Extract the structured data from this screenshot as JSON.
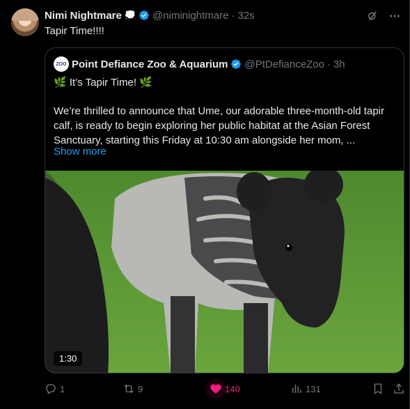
{
  "author": {
    "name": "Nimi Nightmare",
    "emoji": "💭",
    "handle": "@niminightmare",
    "separator": "·",
    "time": "32s"
  },
  "tweet": {
    "text": "Tapir Time!!!!"
  },
  "quoted": {
    "logo_text": "ZOO",
    "name": "Point Defiance Zoo & Aquarium",
    "handle": "@PtDefianceZoo",
    "separator": "·",
    "time": "3h",
    "title": "🌿 It’s Tapir Time! 🌿",
    "body": "We’re thrilled to announce that Ume, our adorable three-month-old tapir calf, is ready to begin exploring her public habitat at the Asian Forest Sanctuary, starting this Friday at 10:30 am alongside her mom, ...",
    "show_more": "Show more",
    "video_duration": "1:30"
  },
  "actions": {
    "replies": "1",
    "reposts": "9",
    "likes": "140",
    "views": "131"
  },
  "icons": {
    "verified": "verified-badge-icon",
    "grok": "grok-icon",
    "more": "more-icon",
    "reply": "reply-icon",
    "repost": "repost-icon",
    "like": "heart-icon",
    "views": "views-icon",
    "bookmark": "bookmark-icon",
    "share": "share-icon"
  },
  "colors": {
    "accent": "#1d9bf0",
    "like": "#f91880",
    "muted": "#71767b",
    "border": "#2f3336",
    "background": "#000000"
  }
}
